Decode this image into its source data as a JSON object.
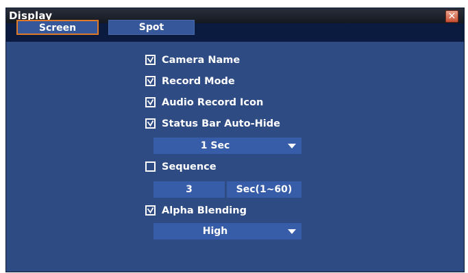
{
  "window": {
    "title": "Display",
    "close_glyph": "✕"
  },
  "tabs": [
    {
      "label": "Screen",
      "active": true
    },
    {
      "label": "Spot",
      "active": false
    }
  ],
  "options": {
    "camera_name": {
      "label": "Camera Name",
      "checked": true
    },
    "record_mode": {
      "label": "Record Mode",
      "checked": true
    },
    "audio_record_icon": {
      "label": "Audio Record Icon",
      "checked": true
    },
    "status_bar_auto_hide": {
      "label": "Status Bar Auto-Hide",
      "checked": true,
      "value": "1 Sec"
    },
    "sequence": {
      "label": "Sequence",
      "checked": false,
      "value": "3",
      "unit": "Sec(1~60)"
    },
    "alpha_blending": {
      "label": "Alpha Blending",
      "checked": true,
      "value": "High"
    }
  },
  "colors": {
    "window_bg": "#2e4b84",
    "tab_bg": "#36589a",
    "active_tab_border": "#e07a28",
    "field_bg": "#385da8",
    "close_button": "#c85033"
  },
  "icons": {
    "close": "close-icon",
    "check": "check-icon",
    "dropdown": "chevron-down-icon"
  }
}
